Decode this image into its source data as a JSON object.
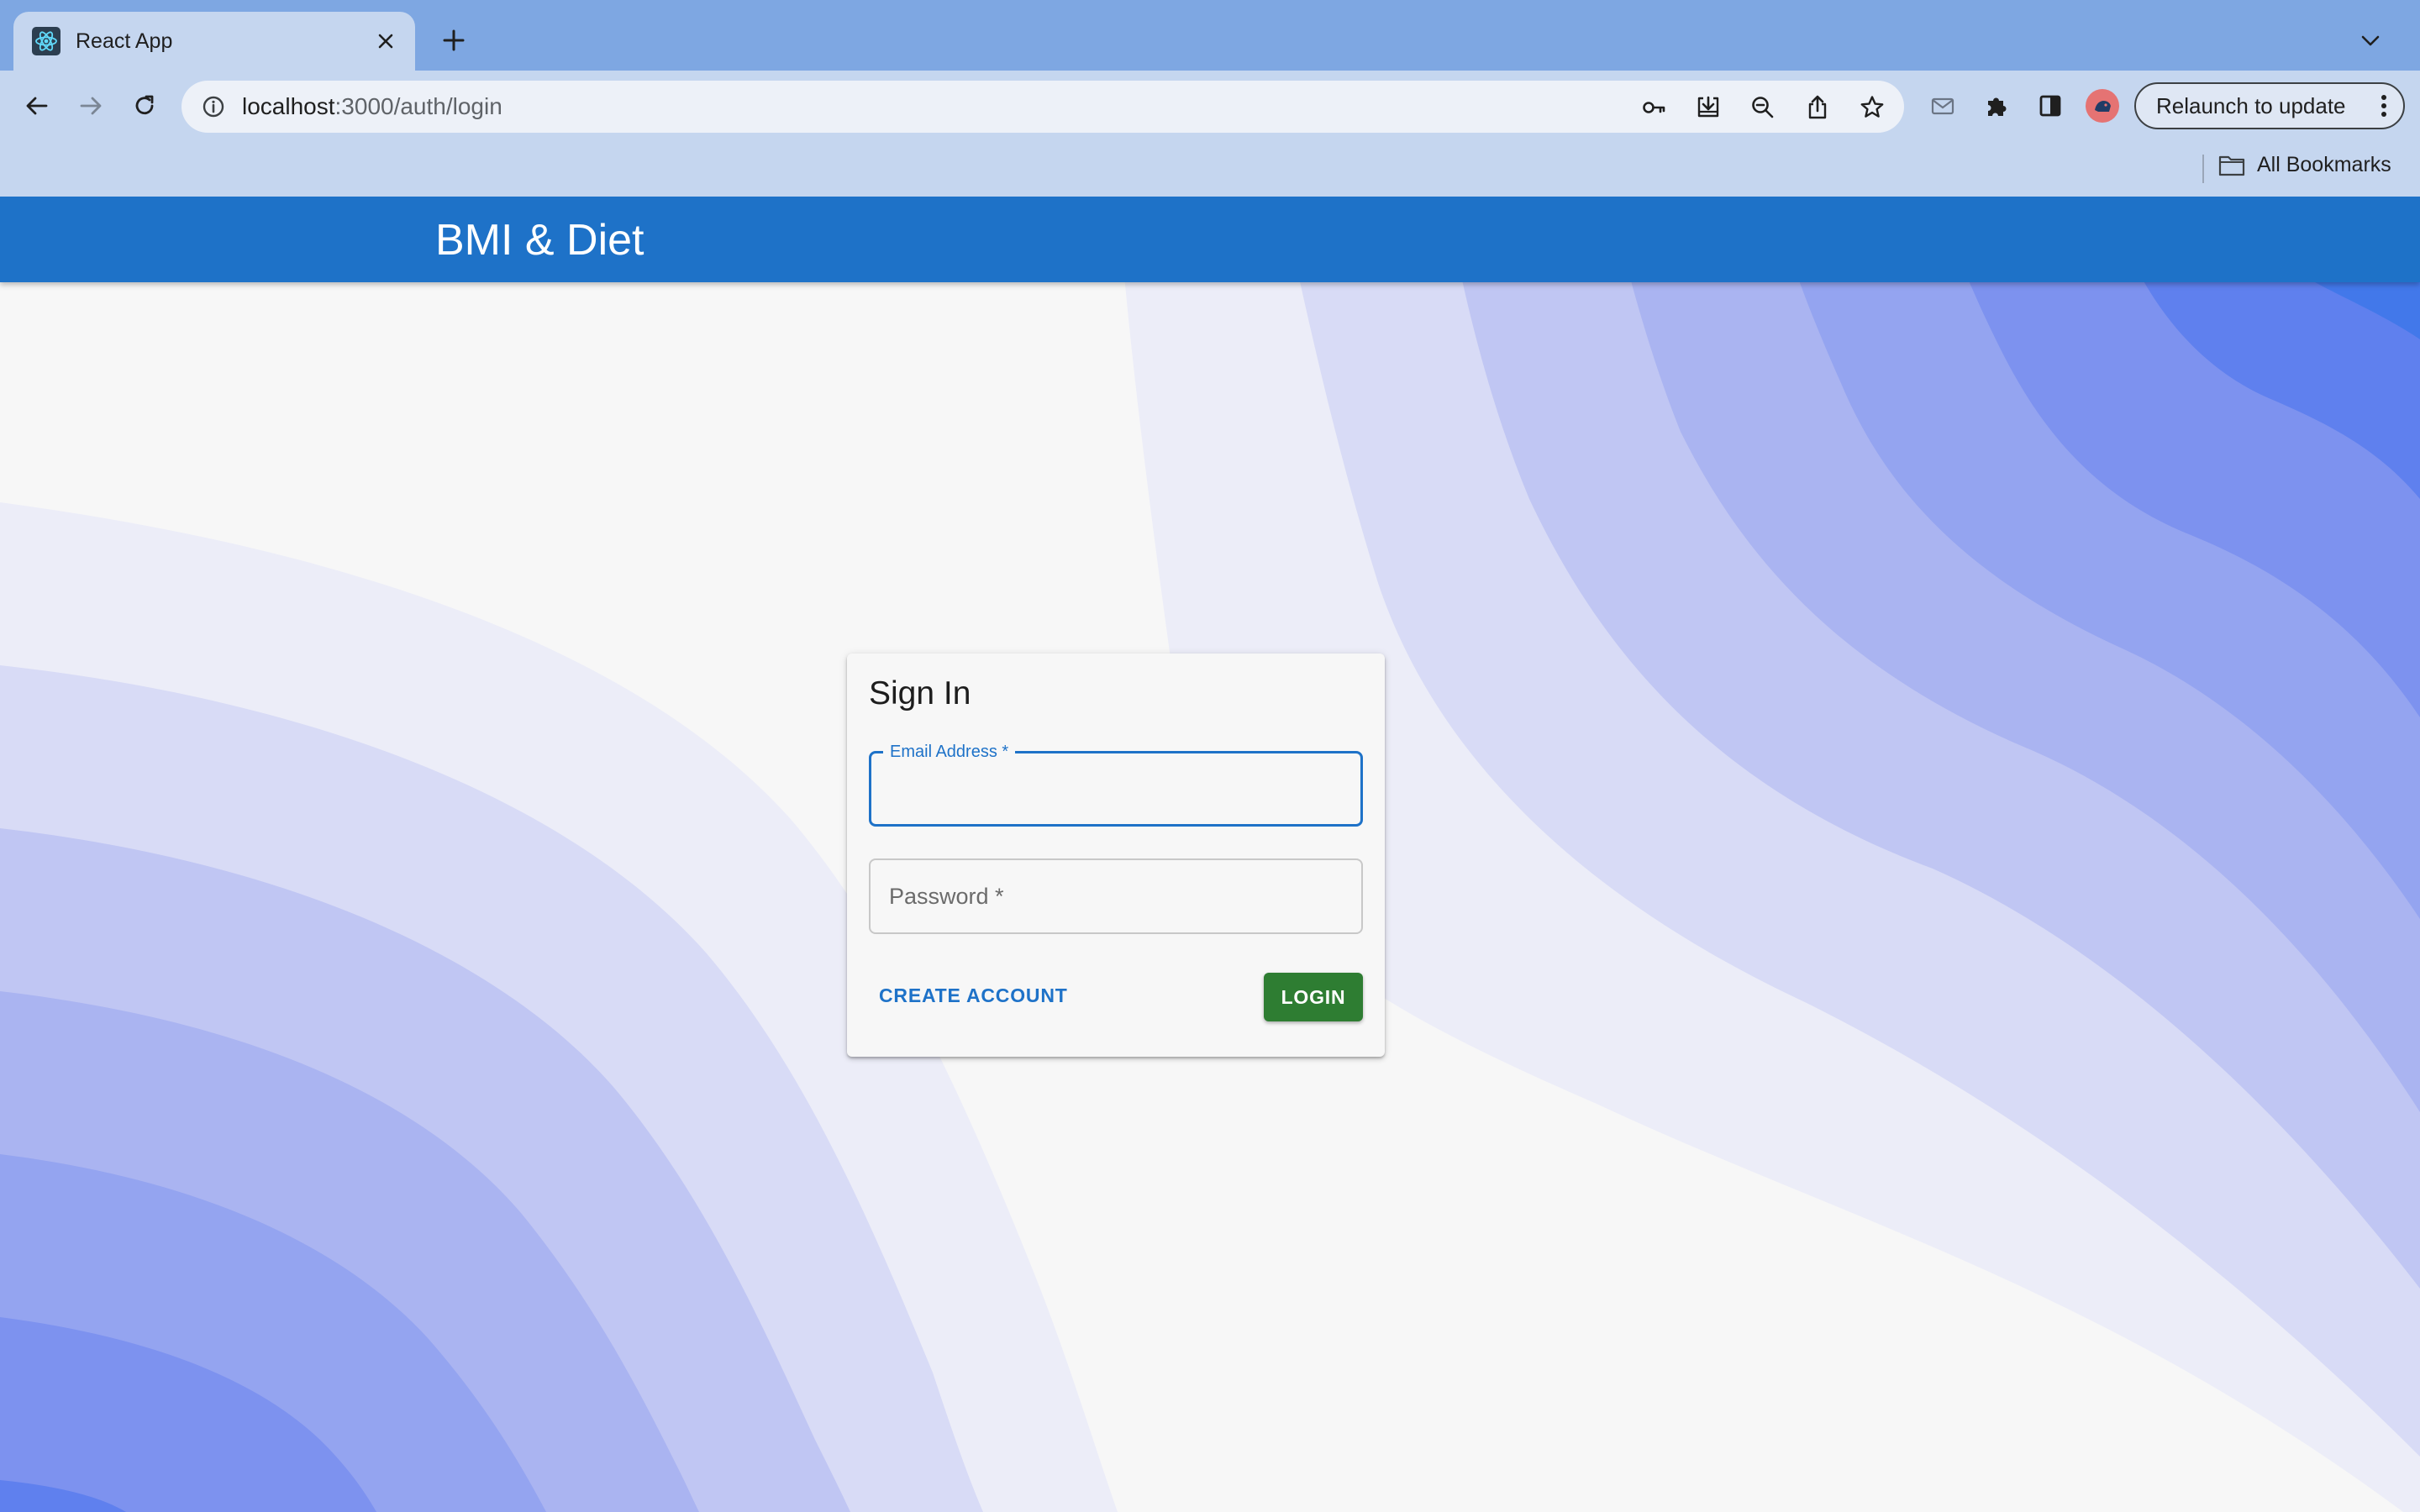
{
  "browser": {
    "tab": {
      "title": "React App"
    },
    "url": {
      "host": "localhost",
      "path": ":3000/auth/login"
    },
    "relaunch_label": "Relaunch to update",
    "bookmarks": {
      "all_bookmarks_label": "All Bookmarks"
    },
    "icons": {
      "tab_favicon": "react-logo-icon",
      "tab_close": "close-icon",
      "new_tab": "plus-icon",
      "tab_list": "chevron-down-icon",
      "back": "arrow-left-icon",
      "forward": "arrow-right-icon",
      "reload": "reload-icon",
      "site_info": "info-icon",
      "omnibox": [
        "key-icon",
        "install-icon",
        "zoom-out-icon",
        "share-icon",
        "star-icon"
      ],
      "extensions": [
        "mail-icon",
        "puzzle-icon",
        "sidepanel-icon",
        "profile-avatar"
      ],
      "menu": "kebab-icon",
      "bookmark_folder": "folder-icon"
    }
  },
  "app": {
    "title": "BMI & Diet",
    "brand_color": "#1e72c8"
  },
  "signin": {
    "heading": "Sign In",
    "email": {
      "label": "Email Address *",
      "value": ""
    },
    "password": {
      "label": "Password *",
      "value": ""
    },
    "create_account_label": "CREATE ACCOUNT",
    "login_label": "LOGIN",
    "login_color": "#2e7d32"
  }
}
